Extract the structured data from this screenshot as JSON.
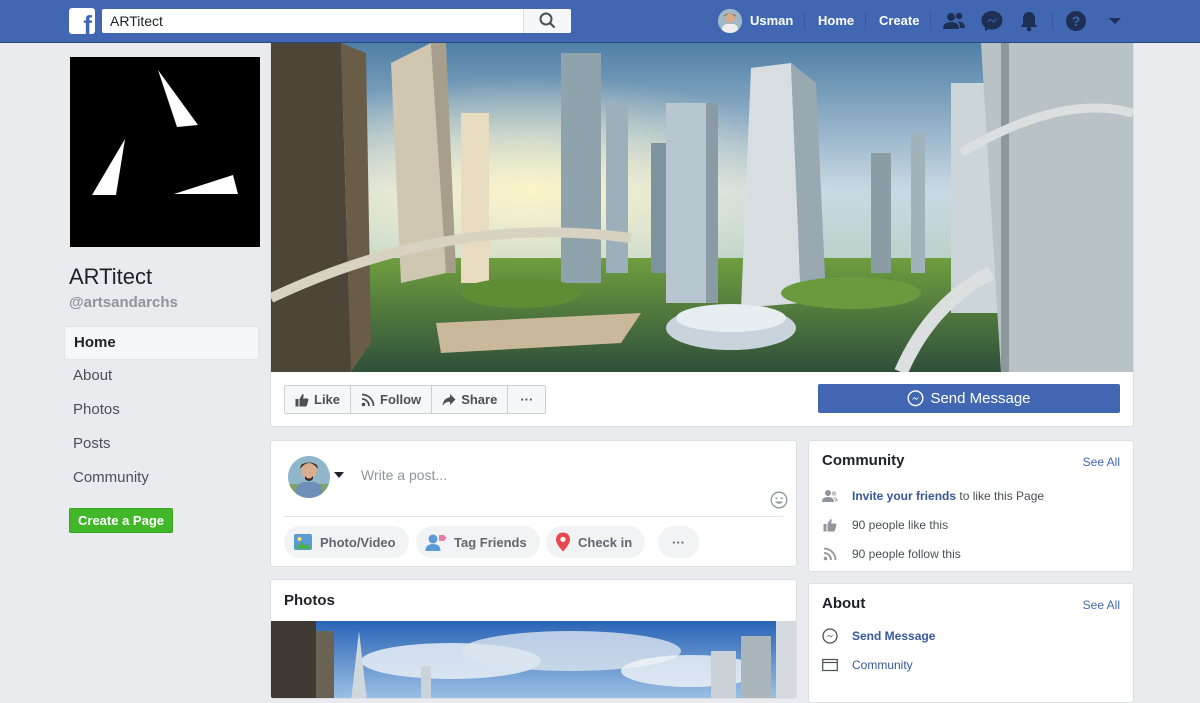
{
  "topbar": {
    "search_value": "ARTitect",
    "user_name": "Usman",
    "home_label": "Home",
    "create_label": "Create"
  },
  "page": {
    "name": "ARTitect",
    "handle": "@artsandarchs"
  },
  "sidebar": {
    "items": [
      {
        "label": "Home",
        "active": true
      },
      {
        "label": "About"
      },
      {
        "label": "Photos"
      },
      {
        "label": "Posts"
      },
      {
        "label": "Community"
      }
    ],
    "create_page_label": "Create a Page"
  },
  "actions": {
    "like": "Like",
    "follow": "Follow",
    "share": "Share",
    "more": "···",
    "send_message": "Send Message"
  },
  "composer": {
    "placeholder": "Write a post...",
    "photo_video": "Photo/Video",
    "tag_friends": "Tag Friends",
    "check_in": "Check in",
    "more": "···"
  },
  "photos": {
    "title": "Photos"
  },
  "community": {
    "title": "Community",
    "see_all": "See All",
    "invite_link": "Invite your friends",
    "invite_rest": " to like this Page",
    "likes": "90 people like this",
    "follows": "90 people follow this"
  },
  "about": {
    "title": "About",
    "see_all": "See All",
    "send_message": "Send Message",
    "category": "Community"
  },
  "colors": {
    "brand_blue": "#4267b2",
    "create_green": "#42b72a",
    "page_bg": "#e9ebee"
  }
}
